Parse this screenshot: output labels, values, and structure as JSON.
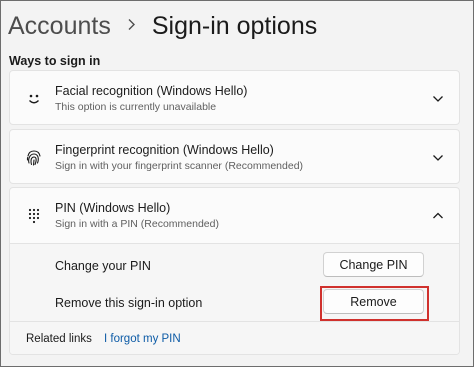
{
  "breadcrumb": {
    "parent": "Accounts",
    "separator": ">",
    "current": "Sign-in options"
  },
  "section": {
    "title": "Ways to sign in"
  },
  "options": [
    {
      "icon": "smiley-face-icon",
      "title": "Facial recognition (Windows Hello)",
      "subtitle": "This option is currently unavailable",
      "expanded": false
    },
    {
      "icon": "fingerprint-icon",
      "title": "Fingerprint recognition (Windows Hello)",
      "subtitle": "Sign in with your fingerprint scanner (Recommended)",
      "expanded": false
    },
    {
      "icon": "pin-keypad-icon",
      "title": "PIN (Windows Hello)",
      "subtitle": "Sign in with a PIN (Recommended)",
      "expanded": true
    }
  ],
  "pin_settings": {
    "change_label": "Change your PIN",
    "change_button": "Change PIN",
    "remove_label": "Remove this sign-in option",
    "remove_button": "Remove"
  },
  "related_links": {
    "label": "Related links",
    "link": "I forgot my PIN"
  },
  "colors": {
    "highlight": "#d0312d",
    "link": "#0d5ba6"
  }
}
